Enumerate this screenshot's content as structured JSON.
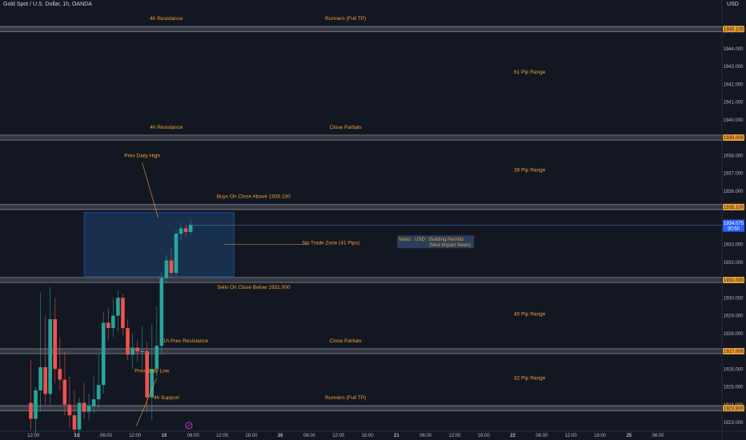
{
  "header": {
    "symbol": "Gold Spot / U.S. Dollar, 1h, OANDA",
    "currency": "USD"
  },
  "colors": {
    "background": "#131722",
    "bull": "#26a69a",
    "bear": "#ef5350",
    "level_band": "#3a3e49",
    "label_orange": "#f0a030",
    "zone_fill": "#1b3a5e",
    "zone_border": "#2962ff",
    "axis_text": "#b2b5be",
    "price_line": "#4a90d9"
  },
  "chart_data": {
    "type": "candlestick",
    "y_axis": {
      "ylim": [
        1922.5,
        1947.0
      ],
      "ticks": [
        1923,
        1924,
        1925,
        1926,
        1927,
        1928,
        1929,
        1930,
        1931,
        1932,
        1933,
        1934,
        1935,
        1936,
        1937,
        1938,
        1939,
        1940,
        1941,
        1942,
        1943,
        1944,
        1945
      ],
      "tick_labels": [
        "1923.000",
        "1924.000",
        "1925.000",
        "1926.000",
        "1927.000",
        "1928.000",
        "1929.000",
        "1930.000",
        "1931.000",
        "1932.000",
        "1933.000",
        "1934.000",
        "1935.000",
        "1936.000",
        "1937.000",
        "1938.000",
        "1939.000",
        "1940.000",
        "1941.000",
        "1942.000",
        "1943.000",
        "1944.000",
        "1945.000"
      ]
    },
    "x_axis": {
      "tick_labels": [
        "12:00",
        "18",
        "06:00",
        "12:00",
        "19",
        "06:00",
        "12:00",
        "18:00",
        "20",
        "06:00",
        "12:00",
        "18:00",
        "21",
        "06:00",
        "12:00",
        "18:00",
        "22",
        "06:00",
        "12:00",
        "18:00",
        "25",
        "06:00"
      ],
      "tick_bars": [
        3,
        12,
        18,
        24,
        30,
        36,
        42,
        48,
        54,
        60,
        66,
        72,
        78,
        84,
        90,
        96,
        102,
        108,
        114,
        120,
        126,
        132
      ]
    },
    "bar_spacing_hours": 1,
    "candles": [
      {
        "o": 1924.1,
        "h": 1926.5,
        "l": 1922.6,
        "c": 1923.2
      },
      {
        "o": 1923.2,
        "h": 1925.0,
        "l": 1922.4,
        "c": 1924.8
      },
      {
        "o": 1924.8,
        "h": 1930.3,
        "l": 1923.6,
        "c": 1926.1
      },
      {
        "o": 1926.1,
        "h": 1929.0,
        "l": 1924.0,
        "c": 1924.6
      },
      {
        "o": 1924.6,
        "h": 1930.6,
        "l": 1924.0,
        "c": 1928.8
      },
      {
        "o": 1928.8,
        "h": 1930.0,
        "l": 1925.2,
        "c": 1926.0
      },
      {
        "o": 1926.0,
        "h": 1927.8,
        "l": 1924.8,
        "c": 1925.4
      },
      {
        "o": 1925.4,
        "h": 1927.0,
        "l": 1923.4,
        "c": 1924.0
      },
      {
        "o": 1924.0,
        "h": 1925.6,
        "l": 1922.7,
        "c": 1923.4
      },
      {
        "o": 1923.4,
        "h": 1924.8,
        "l": 1922.2,
        "c": 1922.6
      },
      {
        "o": 1922.6,
        "h": 1924.4,
        "l": 1922.1,
        "c": 1924.1
      },
      {
        "o": 1924.1,
        "h": 1925.2,
        "l": 1923.2,
        "c": 1923.6
      },
      {
        "o": 1923.6,
        "h": 1924.6,
        "l": 1923.1,
        "c": 1923.9
      },
      {
        "o": 1923.9,
        "h": 1925.6,
        "l": 1923.5,
        "c": 1924.3
      },
      {
        "o": 1924.3,
        "h": 1926.8,
        "l": 1923.8,
        "c": 1925.1
      },
      {
        "o": 1925.1,
        "h": 1929.2,
        "l": 1924.6,
        "c": 1928.6
      },
      {
        "o": 1928.6,
        "h": 1929.4,
        "l": 1927.6,
        "c": 1928.3
      },
      {
        "o": 1928.3,
        "h": 1930.0,
        "l": 1927.8,
        "c": 1929.0
      },
      {
        "o": 1929.0,
        "h": 1930.4,
        "l": 1928.1,
        "c": 1930.0
      },
      {
        "o": 1930.0,
        "h": 1930.2,
        "l": 1927.9,
        "c": 1928.3
      },
      {
        "o": 1928.3,
        "h": 1928.8,
        "l": 1926.5,
        "c": 1926.8
      },
      {
        "o": 1926.8,
        "h": 1928.0,
        "l": 1926.0,
        "c": 1927.2
      },
      {
        "o": 1927.2,
        "h": 1927.6,
        "l": 1926.4,
        "c": 1927.0
      },
      {
        "o": 1927.0,
        "h": 1928.4,
        "l": 1926.0,
        "c": 1927.0
      },
      {
        "o": 1927.0,
        "h": 1927.5,
        "l": 1923.6,
        "c": 1924.4
      },
      {
        "o": 1924.4,
        "h": 1928.5,
        "l": 1923.1,
        "c": 1926.0
      },
      {
        "o": 1926.0,
        "h": 1929.5,
        "l": 1925.6,
        "c": 1927.3
      },
      {
        "o": 1927.3,
        "h": 1931.4,
        "l": 1926.8,
        "c": 1931.1
      },
      {
        "o": 1931.1,
        "h": 1932.4,
        "l": 1930.8,
        "c": 1932.1
      },
      {
        "o": 1932.1,
        "h": 1932.8,
        "l": 1931.1,
        "c": 1931.4
      },
      {
        "o": 1931.4,
        "h": 1933.8,
        "l": 1931.2,
        "c": 1933.6
      },
      {
        "o": 1933.6,
        "h": 1934.2,
        "l": 1933.2,
        "c": 1933.9
      },
      {
        "o": 1933.9,
        "h": 1934.1,
        "l": 1933.4,
        "c": 1933.7
      },
      {
        "o": 1933.7,
        "h": 1934.4,
        "l": 1933.6,
        "c": 1934.1
      }
    ],
    "levels": [
      {
        "price": 1945.1,
        "label": "1945.100",
        "bg": "#f0a030"
      },
      {
        "price": 1939.0,
        "label": "1939.000",
        "bg": "#f0a030"
      },
      {
        "price": 1935.1,
        "label": "1935.100",
        "bg": "#f0a030"
      },
      {
        "price": 1931.0,
        "label": "1931.000",
        "bg": "#f0a030"
      },
      {
        "price": 1927.0,
        "label": "1927.000",
        "bg": "#f0a030"
      },
      {
        "price": 1923.8,
        "label": "1923.800",
        "bg": "#f0a030"
      }
    ],
    "current_price": {
      "price": 1934.075,
      "label": "1934.075",
      "countdown": "30:50"
    },
    "zone": {
      "bar_start": 11,
      "bar_end": 42,
      "top": 1934.8,
      "bottom": 1931.2
    },
    "annotations": [
      {
        "text": "4h Resistance",
        "bar": 28,
        "price": 1945.6
      },
      {
        "text": "Runners (Full TP)",
        "bar": 65,
        "price": 1945.6
      },
      {
        "text": "61 Pip Range",
        "bar": 103,
        "price": 1942.6
      },
      {
        "text": "4h Resistance",
        "bar": 28,
        "price": 1939.5
      },
      {
        "text": "Close Partials",
        "bar": 65,
        "price": 1939.5
      },
      {
        "text": "Prev Daily High",
        "bar": 23,
        "price": 1937.9
      },
      {
        "text": "39 Pip Range",
        "bar": 103,
        "price": 1937.1
      },
      {
        "text": "Buys On Close Above 1935.100",
        "bar": 46,
        "price": 1935.6
      },
      {
        "text": "No Trade Zone (41 Pips)",
        "bar": 62,
        "price": 1933.0
      },
      {
        "text": "Sells On Close Below 1931.000",
        "bar": 46,
        "price": 1930.5
      },
      {
        "text": "40 Pip Range",
        "bar": 103,
        "price": 1929.0
      },
      {
        "text": "1h Prev Resistance",
        "bar": 32,
        "price": 1927.5
      },
      {
        "text": "Close Partials",
        "bar": 65,
        "price": 1927.5
      },
      {
        "text": "Prev Daily Low",
        "bar": 25,
        "price": 1925.8
      },
      {
        "text": "32 Pip Range",
        "bar": 103,
        "price": 1925.4
      },
      {
        "text": "4h Support",
        "bar": 28,
        "price": 1924.3
      },
      {
        "text": "Runners (Full TP)",
        "bar": 65,
        "price": 1924.3
      }
    ],
    "news_box": {
      "lines": [
        "News : USD : Building Permits",
        "(Med Impact News)"
      ],
      "bar": 76,
      "price": 1933.1
    },
    "arrows": [
      {
        "from_bar": 23,
        "from_price": 1937.6,
        "to_bar": 26.3,
        "to_price": 1934.5
      },
      {
        "from_bar": 26,
        "from_price": 1925.5,
        "to_bar": 21.8,
        "to_price": 1922.8
      },
      {
        "from_bar": 57.5,
        "from_price": 1933.0,
        "to_bar": 40,
        "to_price": 1933.0
      }
    ]
  }
}
